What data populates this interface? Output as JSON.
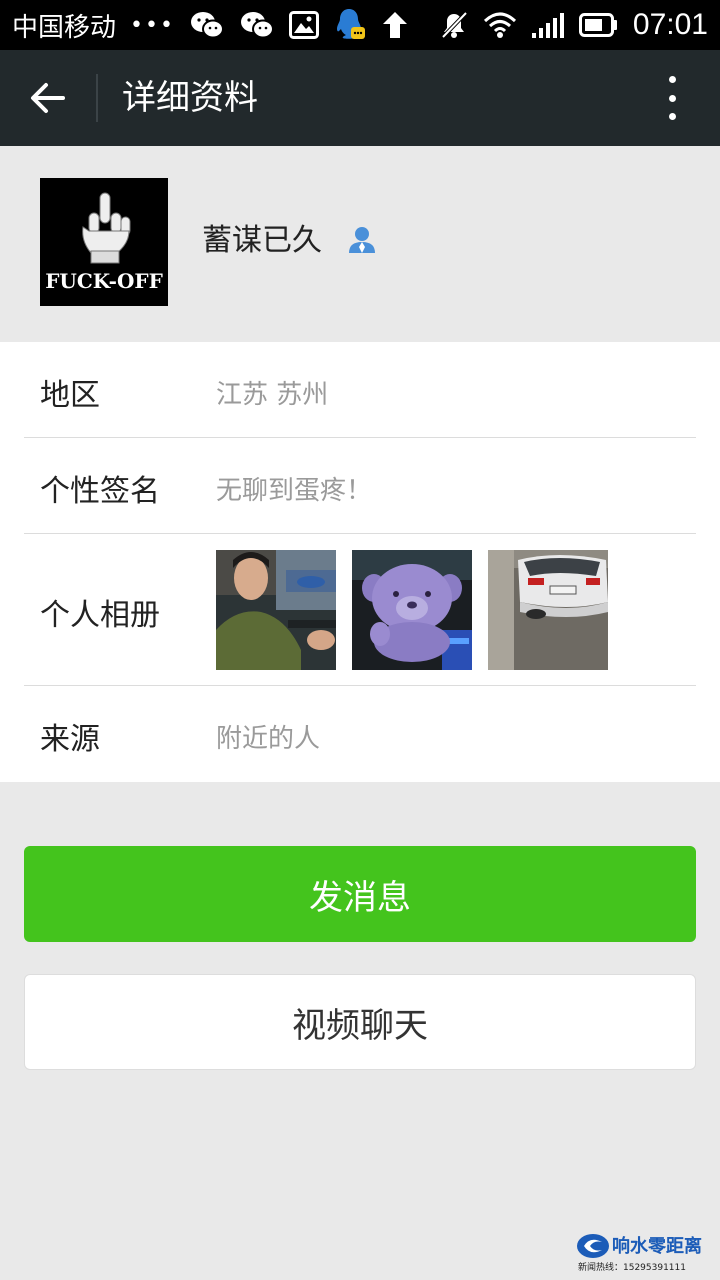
{
  "status_bar": {
    "carrier": "中国移动",
    "dots": "•••",
    "time": "07:01",
    "icons": [
      "wechat-icon",
      "wechat-icon",
      "image-icon",
      "qq-icon",
      "upload-arrow-icon",
      "mute-icon",
      "wifi-icon",
      "signal-icon",
      "battery-icon"
    ]
  },
  "app_bar": {
    "title": "详细资料",
    "back_icon": "back-arrow-icon",
    "more_icon": "more-vertical-icon"
  },
  "profile": {
    "name": "蓄谋已久",
    "avatar_text": "FUCK-OFF",
    "gender_icon": "person-icon"
  },
  "info": {
    "region": {
      "label": "地区",
      "value": "江苏  苏州"
    },
    "signature": {
      "label": "个性签名",
      "value": "无聊到蛋疼！"
    },
    "album": {
      "label": "个人相册",
      "photos": [
        "photo-person-in-car",
        "photo-purple-bear",
        "photo-white-car"
      ]
    },
    "source": {
      "label": "来源",
      "value": "附近的人"
    }
  },
  "actions": {
    "send_message": "发消息",
    "video_chat": "视频聊天"
  },
  "colors": {
    "status_bar": "#000000",
    "app_bar": "#22292c",
    "primary_button": "#44c41d",
    "background": "#e9e9e9"
  },
  "watermark": {
    "title": "响水零距离",
    "subtitle": "新闻热线：15295391111"
  }
}
